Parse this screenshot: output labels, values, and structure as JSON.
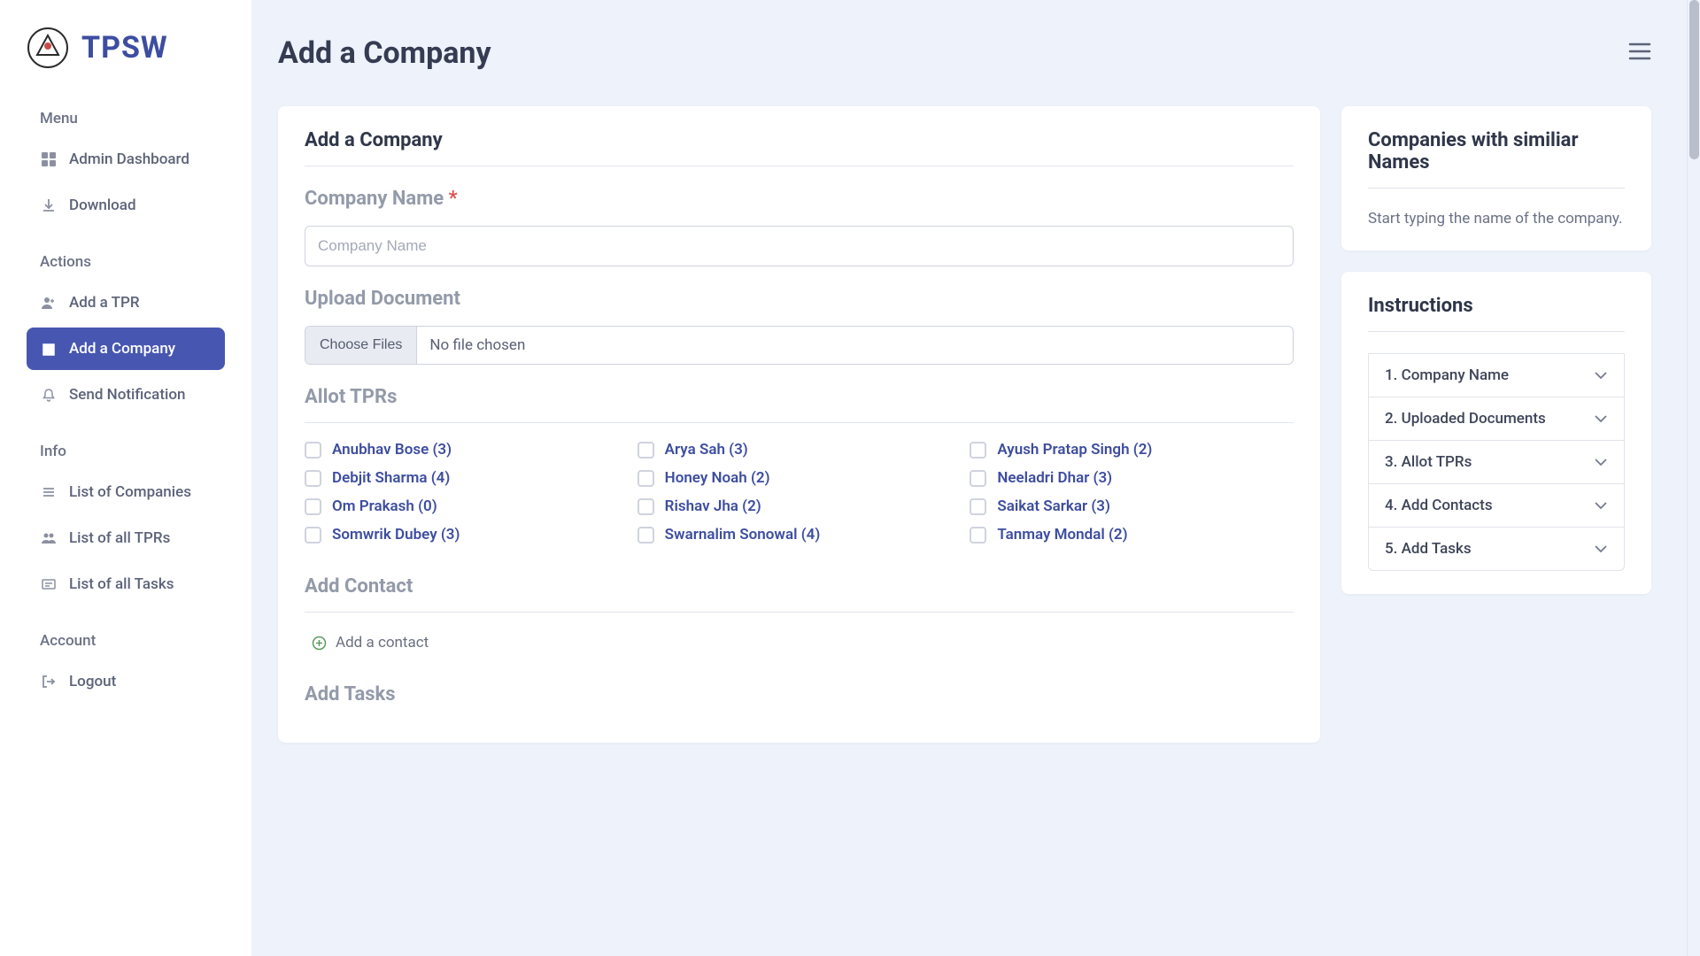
{
  "brand": {
    "title": "TPSW"
  },
  "sidebar": {
    "sections": [
      {
        "heading": "Menu",
        "items": [
          {
            "label": "Admin Dashboard",
            "icon": "dashboard-icon",
            "active": false
          },
          {
            "label": "Download",
            "icon": "download-icon",
            "active": false
          }
        ]
      },
      {
        "heading": "Actions",
        "items": [
          {
            "label": "Add a TPR",
            "icon": "person-add-icon",
            "active": false
          },
          {
            "label": "Add a Company",
            "icon": "building-icon",
            "active": true
          },
          {
            "label": "Send Notification",
            "icon": "bell-icon",
            "active": false
          }
        ]
      },
      {
        "heading": "Info",
        "items": [
          {
            "label": "List of Companies",
            "icon": "list-icon",
            "active": false
          },
          {
            "label": "List of all TPRs",
            "icon": "people-icon",
            "active": false
          },
          {
            "label": "List of all Tasks",
            "icon": "card-list-icon",
            "active": false
          }
        ]
      },
      {
        "heading": "Account",
        "items": [
          {
            "label": "Logout",
            "icon": "logout-icon",
            "active": false
          }
        ]
      }
    ]
  },
  "header": {
    "title": "Add a Company"
  },
  "form": {
    "card_title": "Add a Company",
    "company_name": {
      "label": "Company Name ",
      "required_mark": "*",
      "placeholder": "Company Name"
    },
    "upload": {
      "label": "Upload Document",
      "button": "Choose Files",
      "status": "No file chosen"
    },
    "allot_label": "Allot TPRs",
    "tprs": [
      "Anubhav Bose (3)",
      "Arya Sah (3)",
      "Ayush Pratap Singh (2)",
      "Debjit Sharma (4)",
      "Honey Noah (2)",
      "Neeladri Dhar (3)",
      "Om Prakash (0)",
      "Rishav Jha (2)",
      "Saikat Sarkar (3)",
      "Somwrik Dubey (3)",
      "Swarnalim Sonowal (4)",
      "Tanmay Mondal (2)"
    ],
    "add_contact_label": "Add Contact",
    "add_contact_link": "Add a contact",
    "add_tasks_label": "Add Tasks"
  },
  "similar": {
    "title": "Companies with similiar Names",
    "hint": "Start typing the name of the company."
  },
  "instructions": {
    "title": "Instructions",
    "items": [
      "1. Company Name",
      "2. Uploaded Documents",
      "3. Allot TPRs",
      "4. Add Contacts",
      "5. Add Tasks"
    ]
  }
}
